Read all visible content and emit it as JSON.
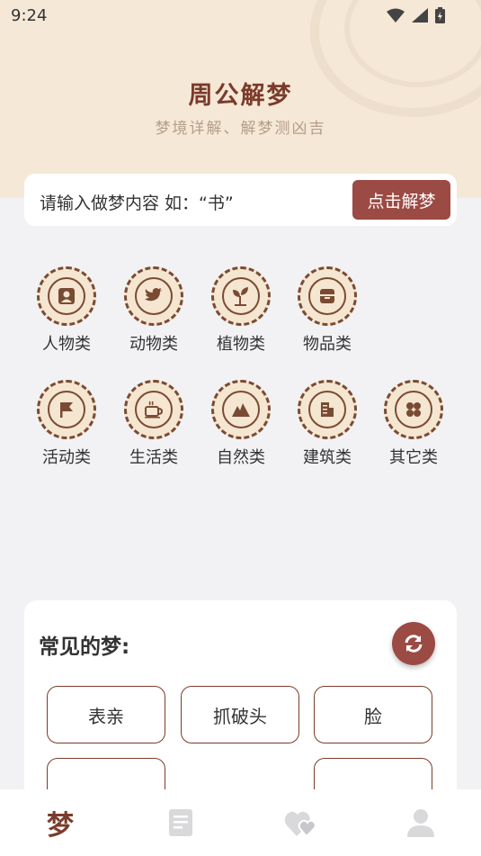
{
  "status_bar": {
    "time": "9:24"
  },
  "header": {
    "title": "周公解梦",
    "subtitle": "梦境详解、解梦测凶吉"
  },
  "search": {
    "placeholder": "请输入做梦内容 如：“书”",
    "button_label": "点击解梦"
  },
  "categories": [
    {
      "label": "人物类",
      "icon": "person-icon"
    },
    {
      "label": "动物类",
      "icon": "bird-icon"
    },
    {
      "label": "植物类",
      "icon": "sprout-icon"
    },
    {
      "label": "物品类",
      "icon": "box-icon"
    },
    {
      "label": "活动类",
      "icon": "flag-icon"
    },
    {
      "label": "生活类",
      "icon": "cup-icon"
    },
    {
      "label": "自然类",
      "icon": "mountain-icon"
    },
    {
      "label": "建筑类",
      "icon": "building-icon"
    },
    {
      "label": "其它类",
      "icon": "clover-icon"
    }
  ],
  "common_dreams": {
    "heading": "常见的梦:",
    "tags": [
      "表亲",
      "抓破头",
      "脸"
    ]
  },
  "tabbar": {
    "active_tab": "dream",
    "tab1_label": "梦"
  },
  "colors": {
    "accent": "#9b4a44",
    "title": "#7b3b2b",
    "header_bg": "#f5e8d7"
  }
}
